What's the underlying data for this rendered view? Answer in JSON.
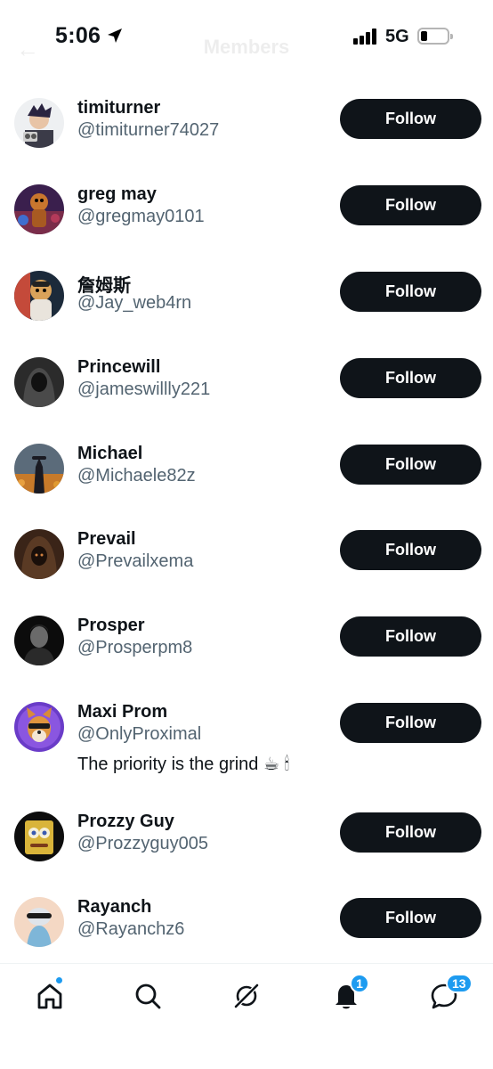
{
  "status_bar": {
    "time": "5:06",
    "network": "5G"
  },
  "header": {
    "title": "Members",
    "back_icon": "back-arrow-icon"
  },
  "members": [
    {
      "name": "timiturner",
      "handle": "@timiturner74027",
      "bio": "",
      "follow_label": "Follow"
    },
    {
      "name": "greg may",
      "handle": "@gregmay0101",
      "bio": "",
      "follow_label": "Follow"
    },
    {
      "name": "詹姆斯",
      "handle": "@Jay_web4rn",
      "bio": "",
      "follow_label": "Follow"
    },
    {
      "name": "Princewill",
      "handle": "@jameswillly221",
      "bio": "",
      "follow_label": "Follow"
    },
    {
      "name": "Michael",
      "handle": "@Michaele82z",
      "bio": "",
      "follow_label": "Follow"
    },
    {
      "name": "Prevail",
      "handle": "@Prevailxema",
      "bio": "",
      "follow_label": "Follow"
    },
    {
      "name": "Prosper",
      "handle": "@Prosperpm8",
      "bio": "",
      "follow_label": "Follow"
    },
    {
      "name": "Maxi Prom",
      "handle": "@OnlyProximal",
      "bio": "The priority is the grind ☕ 🕯",
      "follow_label": "Follow"
    },
    {
      "name": "Prozzy Guy",
      "handle": "@Prozzyguy005",
      "bio": "",
      "follow_label": "Follow"
    },
    {
      "name": "Rayanch",
      "handle": "@Rayanchz6",
      "bio": "",
      "follow_label": "Follow"
    }
  ],
  "bottom_nav": {
    "items": [
      "home-icon",
      "search-icon",
      "grok-icon",
      "notifications-icon",
      "messages-icon"
    ],
    "notifications_badge": "1",
    "messages_badge": "13"
  },
  "colors": {
    "accent": "#1d9bf0",
    "button": "#0f1419",
    "secondary_text": "#536471"
  }
}
